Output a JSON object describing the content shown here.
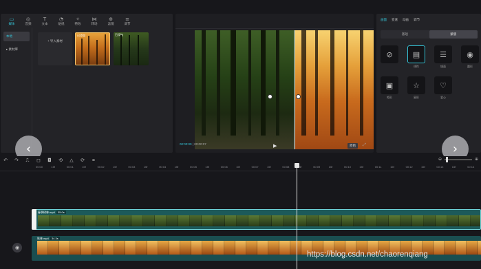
{
  "media_tabs": [
    {
      "label": "媒体",
      "icon": "▭",
      "name": "media"
    },
    {
      "label": "音频",
      "icon": "◎",
      "name": "audio"
    },
    {
      "label": "文本",
      "icon": "T",
      "name": "text"
    },
    {
      "label": "贴纸",
      "icon": "◔",
      "name": "sticker"
    },
    {
      "label": "特效",
      "icon": "✧",
      "name": "effects"
    },
    {
      "label": "转场",
      "icon": "⋈",
      "name": "transition"
    },
    {
      "label": "滤镜",
      "icon": "⊕",
      "name": "filter"
    },
    {
      "label": "调节",
      "icon": "≡",
      "name": "adjust"
    }
  ],
  "media_sidebar": [
    "本地",
    "▸ 素材库"
  ],
  "import_label": "+ 导入素材",
  "thumbnails": [
    "已添加",
    "已添加"
  ],
  "timecode": {
    "current": "00:00:00",
    "total": "00:00:07"
  },
  "preview_ratio": "原始",
  "props_tabs": [
    "画面",
    "变速",
    "动画",
    "调节"
  ],
  "props_segments": [
    "基础",
    "蒙版"
  ],
  "masks": [
    {
      "label": "",
      "icon": "⊘"
    },
    {
      "label": "线性",
      "icon": "▤"
    },
    {
      "label": "镜面",
      "icon": "☰"
    },
    {
      "label": "圆形",
      "icon": "◉"
    },
    {
      "label": "矩形",
      "icon": "▣"
    },
    {
      "label": "星形",
      "icon": "☆"
    },
    {
      "label": "爱心",
      "icon": "♡"
    }
  ],
  "ruler_ticks": [
    "00:00",
    "15f",
    "00:01",
    "15f",
    "00:02",
    "15f",
    "00:03",
    "15f",
    "00:04",
    "15f",
    "00:05",
    "15f",
    "00:06",
    "15f",
    "00:07",
    "15f",
    "00:08",
    "15f",
    "00:09",
    "15f",
    "00:10",
    "15f",
    "00:11",
    "15f",
    "00:12",
    "15f",
    "00:13",
    "15f",
    "00:14"
  ],
  "track1": {
    "name": "春季树林.mp4",
    "duration": "35.0s"
  },
  "track2": {
    "name": "秋林.mp4",
    "duration": "34.3s"
  },
  "watermark": "https://blog.csdn.net/chaorenqiang",
  "accent_color": "#35c3d6"
}
